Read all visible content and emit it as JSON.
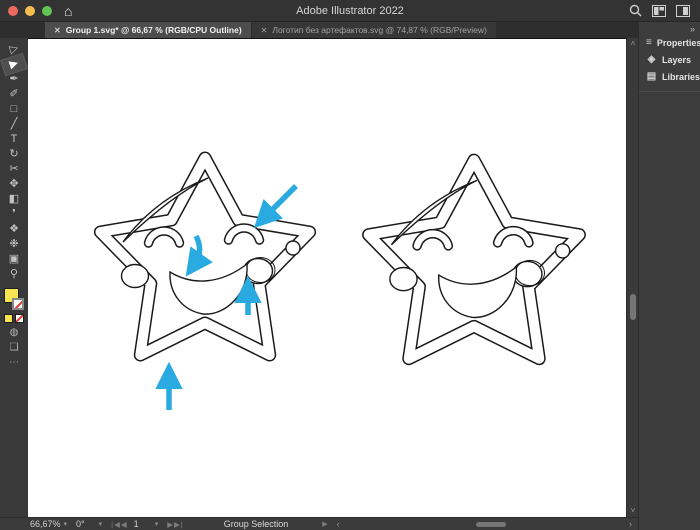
{
  "window": {
    "title": "Adobe Illustrator 2022",
    "home_icon": "⌂",
    "traffic_lights": [
      "#EC6A5E",
      "#F5BF4F",
      "#61C454"
    ]
  },
  "tabs": [
    {
      "label": "Group 1.svg* @ 66,67 % (RGB/CPU Outline)",
      "close": "✕",
      "active": true
    },
    {
      "label": "Логотип без артефактов.svg @ 74,87 % (RGB/Preview)",
      "close": "✕",
      "active": false
    }
  ],
  "panel_collapse_icon": "»",
  "toolbar": {
    "tools": [
      {
        "name": "selection-tool",
        "glyph": "▷"
      },
      {
        "name": "direct-selection-tool",
        "glyph": "▶",
        "selected": true
      },
      {
        "name": "pen-tool",
        "glyph": "✒"
      },
      {
        "name": "paintbrush-tool",
        "glyph": "✐"
      },
      {
        "name": "rectangle-tool",
        "glyph": "□"
      },
      {
        "name": "pencil-tool",
        "glyph": "╱"
      },
      {
        "name": "type-tool",
        "glyph": "T"
      },
      {
        "name": "rotate-tool",
        "glyph": "↻"
      },
      {
        "name": "scissors-tool",
        "glyph": "✂"
      },
      {
        "name": "scale-tool",
        "glyph": "✥"
      },
      {
        "name": "gradient-tool",
        "glyph": "◧"
      },
      {
        "name": "eyedropper-tool",
        "glyph": "❜"
      },
      {
        "name": "blend-tool",
        "glyph": "❖"
      },
      {
        "name": "symbol-sprayer-tool",
        "glyph": "❉"
      },
      {
        "name": "artboard-tool",
        "glyph": "▣"
      },
      {
        "name": "zoom-tool",
        "glyph": "⚲"
      }
    ],
    "fill_color": "#F6E551",
    "stroke_none_slash": "#E13A2E",
    "draw_mode_icon": "◍",
    "screen_mode_icon": "❑",
    "more_icon": "⋯"
  },
  "panel": {
    "items": [
      {
        "name": "properties",
        "label": "Properties",
        "glyph": "≡"
      },
      {
        "name": "layers",
        "label": "Layers",
        "glyph": "◈"
      },
      {
        "name": "libraries",
        "label": "Libraries",
        "glyph": "▤"
      }
    ]
  },
  "statusbar": {
    "zoom": "66,67%",
    "rotation": "0°",
    "artboard_number": "1",
    "nav_first": "|◀",
    "nav_prev": "◀",
    "nav_next": "▶",
    "nav_last": "▶|",
    "tool_status": "Group Selection",
    "expander": "▶",
    "chevron": "▾",
    "scroll_left": "‹",
    "scroll_right": "›",
    "vscroll_up": "˄",
    "vscroll_down": "˅"
  },
  "canvas": {
    "annotation_color": "#29ABE2",
    "annotation_arrow_count": 4,
    "artwork": "two smiling star outlines (left with artifact arrows, right clean)"
  }
}
